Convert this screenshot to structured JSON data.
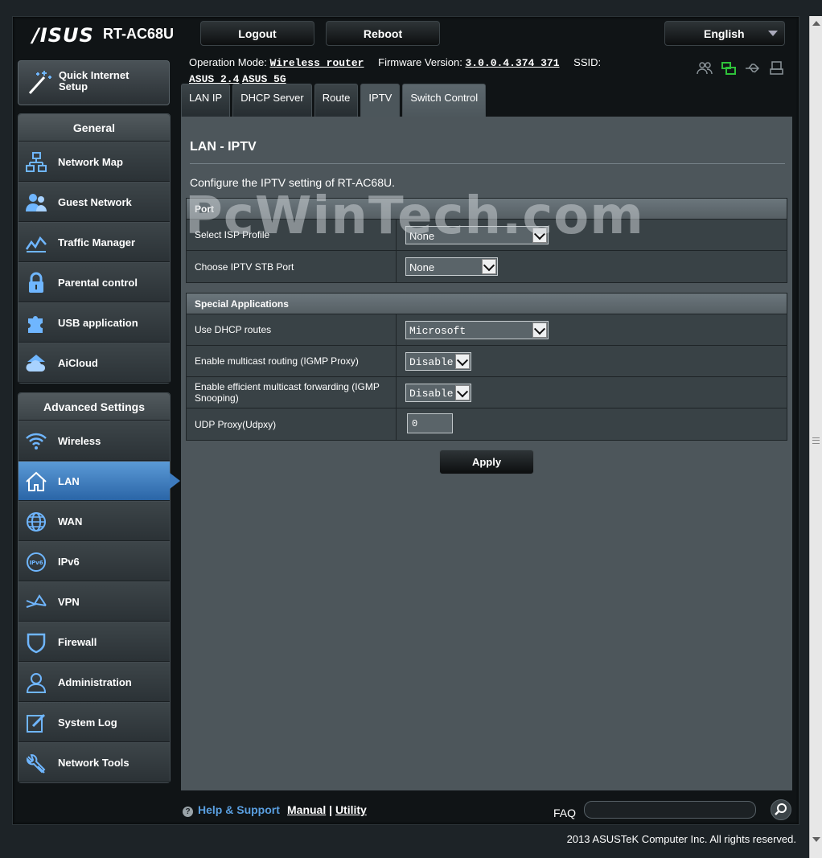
{
  "header": {
    "brand": "/ISUS",
    "model": "RT-AC68U",
    "logout_label": "Logout",
    "reboot_label": "Reboot",
    "language": "English"
  },
  "opinfo": {
    "mode_label": "Operation Mode:",
    "mode_value": "Wireless router",
    "fw_label": "Firmware Version:",
    "fw_value": "3.0.0.4.374_371",
    "ssid_label": "SSID:",
    "ssid_1": "ASUS_2.4",
    "ssid_2": "ASUS_5G"
  },
  "status_icons": [
    "clients-icon",
    "network-icon",
    "usb-icon",
    "printer-icon"
  ],
  "quick_setup": {
    "label_1": "Quick Internet",
    "label_2": "Setup"
  },
  "general": {
    "title": "General",
    "items": [
      {
        "label": "Network Map",
        "icon": "network-map-icon"
      },
      {
        "label": "Guest Network",
        "icon": "guest-network-icon"
      },
      {
        "label": "Traffic Manager",
        "icon": "traffic-manager-icon"
      },
      {
        "label": "Parental control",
        "icon": "lock-icon"
      },
      {
        "label": "USB application",
        "icon": "puzzle-icon"
      },
      {
        "label": "AiCloud",
        "icon": "cloud-icon"
      }
    ]
  },
  "advanced": {
    "title": "Advanced Settings",
    "items": [
      {
        "label": "Wireless",
        "icon": "wifi-icon"
      },
      {
        "label": "LAN",
        "icon": "home-icon"
      },
      {
        "label": "WAN",
        "icon": "globe-icon"
      },
      {
        "label": "IPv6",
        "icon": "ipv6-icon"
      },
      {
        "label": "VPN",
        "icon": "vpn-icon"
      },
      {
        "label": "Firewall",
        "icon": "shield-icon"
      },
      {
        "label": "Administration",
        "icon": "admin-icon"
      },
      {
        "label": "System Log",
        "icon": "system-log-icon"
      },
      {
        "label": "Network Tools",
        "icon": "tools-icon"
      }
    ],
    "active": "LAN"
  },
  "tabs": [
    "LAN IP",
    "DHCP Server",
    "Route",
    "IPTV",
    "Switch Control"
  ],
  "active_tab": "IPTV",
  "content": {
    "title": "LAN - IPTV",
    "description": "Configure the IPTV setting of RT-AC68U.",
    "watermark": "PcWinTech.com",
    "port": {
      "header": "Port",
      "rows": [
        {
          "label": "Select ISP Profile",
          "value": "None"
        },
        {
          "label": "Choose IPTV STB Port",
          "value": "None"
        }
      ]
    },
    "special": {
      "header": "Special Applications",
      "rows": [
        {
          "label": "Use DHCP routes",
          "value": "Microsoft"
        },
        {
          "label": "Enable multicast routing (IGMP Proxy)",
          "value": "Disable"
        },
        {
          "label": "Enable efficient multicast forwarding (IGMP Snooping)",
          "value": "Disable"
        },
        {
          "label": "UDP Proxy(Udpxy)",
          "value": "0"
        }
      ]
    },
    "apply_label": "Apply"
  },
  "footer": {
    "help": "Help & Support",
    "manual": "Manual",
    "separator": "|",
    "utility": "Utility",
    "faq": "FAQ",
    "copyright": "2013 ASUSTeK Computer Inc. All rights reserved."
  }
}
